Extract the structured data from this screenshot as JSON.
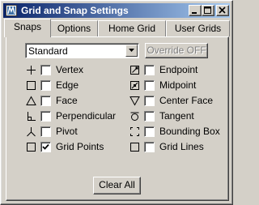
{
  "window": {
    "title": "Grid and Snap Settings"
  },
  "tabs": [
    {
      "label": "Snaps",
      "active": true
    },
    {
      "label": "Options",
      "active": false
    },
    {
      "label": "Home Grid",
      "active": false
    },
    {
      "label": "User Grids",
      "active": false
    }
  ],
  "dropdown": {
    "value": "Standard"
  },
  "override_label": "Override OFF",
  "snaps_left": [
    {
      "label": "Vertex",
      "icon": "plus-icon",
      "checked": false
    },
    {
      "label": "Edge",
      "icon": "square-icon",
      "checked": false
    },
    {
      "label": "Face",
      "icon": "triangle-icon",
      "checked": false
    },
    {
      "label": "Perpendicular",
      "icon": "perpendicular-icon",
      "checked": false
    },
    {
      "label": "Pivot",
      "icon": "pivot-icon",
      "checked": false
    },
    {
      "label": "Grid Points",
      "icon": "grid-point-icon",
      "checked": true
    }
  ],
  "snaps_right": [
    {
      "label": "Endpoint",
      "icon": "endpoint-icon",
      "checked": false
    },
    {
      "label": "Midpoint",
      "icon": "midpoint-icon",
      "checked": false
    },
    {
      "label": "Center Face",
      "icon": "inverted-triangle-icon",
      "checked": false
    },
    {
      "label": "Tangent",
      "icon": "tangent-icon",
      "checked": false
    },
    {
      "label": "Bounding Box",
      "icon": "bounding-box-icon",
      "checked": false
    },
    {
      "label": "Grid Lines",
      "icon": "grid-line-icon",
      "checked": false
    }
  ],
  "clear_all_label": "Clear All",
  "colors": {
    "titlebar_start": "#0a246a",
    "titlebar_end": "#a6caf0",
    "face": "#d4d0c8",
    "disabled_text": "#808080"
  }
}
